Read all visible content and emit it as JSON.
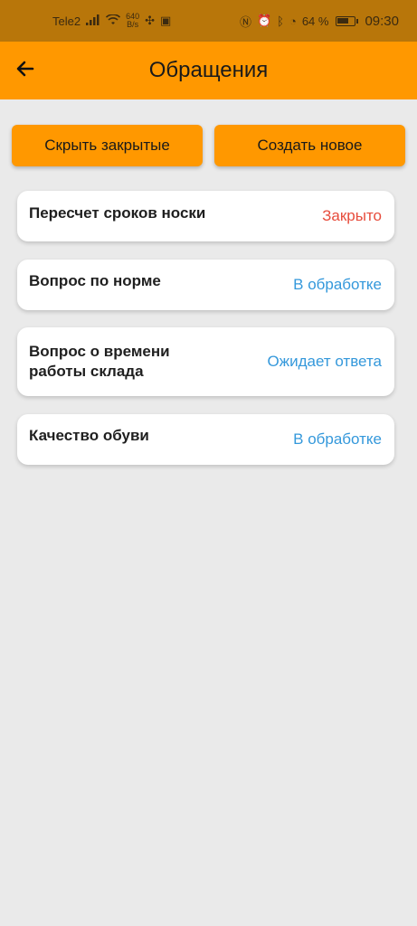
{
  "status_bar": {
    "carrier": "Tele2",
    "net_speed_value": "640",
    "net_speed_unit": "B/s",
    "battery_percent": "64 %",
    "battery_level": 0.64,
    "time": "09:30"
  },
  "appbar": {
    "title": "Обращения",
    "back_icon": "arrow-left-icon"
  },
  "actions": {
    "hide_closed_label": "Скрыть закрытые",
    "create_new_label": "Создать новое"
  },
  "colors": {
    "accent": "#ff9800",
    "status_closed": "#e74c3c",
    "status_processing": "#3498db",
    "status_waiting": "#3498db"
  },
  "tickets": [
    {
      "title": "Пересчет сроков носки",
      "status": "Закрыто",
      "status_type": "closed"
    },
    {
      "title": "Вопрос по норме",
      "status": "В обработке",
      "status_type": "processing"
    },
    {
      "title": "Вопрос о времени работы склада",
      "status": "Ожидает ответа",
      "status_type": "waiting"
    },
    {
      "title": "Качество обуви",
      "status": "В обработке",
      "status_type": "processing"
    }
  ]
}
